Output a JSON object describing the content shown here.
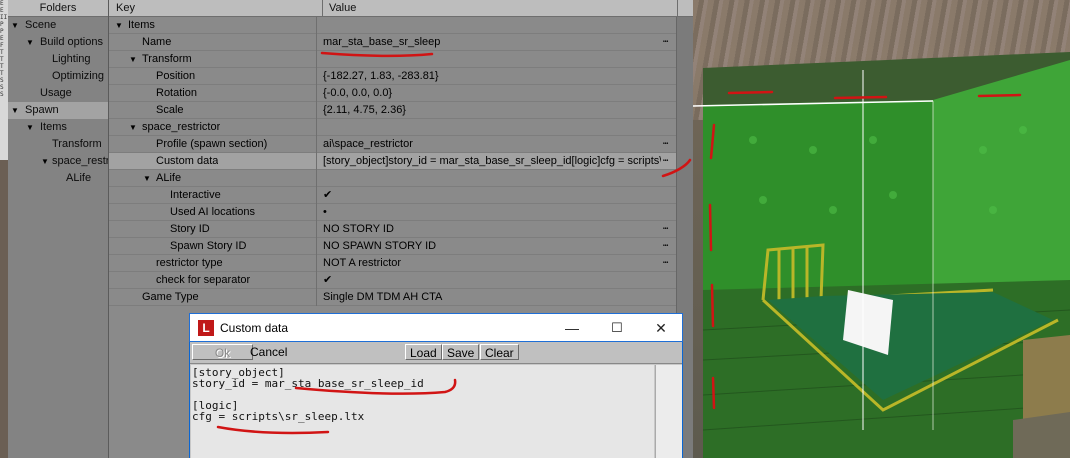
{
  "left_strip_letters": [
    "E",
    "E",
    "II",
    "",
    "P",
    "P",
    "E",
    "F",
    "",
    "T",
    "T",
    "T",
    "T",
    "",
    "S",
    "S",
    "S"
  ],
  "folders": {
    "header": "Folders",
    "items": [
      {
        "label": "Scene",
        "expanded": true
      },
      {
        "label": "Build options",
        "expanded": true
      },
      {
        "label": "Lighting"
      },
      {
        "label": "Optimizing"
      },
      {
        "label": "Usage"
      },
      {
        "label": "Spawn",
        "expanded": true,
        "selected": true
      },
      {
        "label": "Items",
        "expanded": true
      },
      {
        "label": "Transform"
      },
      {
        "label": "space_restrictor",
        "expanded": true
      },
      {
        "label": "ALife"
      }
    ]
  },
  "properties": {
    "key_header": "Key",
    "value_header": "Value",
    "rows": [
      {
        "key": "Items",
        "value": "",
        "expanded": true
      },
      {
        "key": "Name",
        "value": "mar_sta_base_sr_sleep",
        "has_button": true
      },
      {
        "key": "Transform",
        "value": "",
        "expanded": true
      },
      {
        "key": "Position",
        "value": "{-182.27, 1.83, -283.81}"
      },
      {
        "key": "Rotation",
        "value": "{-0.0, 0.0, 0.0}"
      },
      {
        "key": "Scale",
        "value": "{2.11, 4.75, 2.36}"
      },
      {
        "key": "space_restrictor",
        "value": "",
        "expanded": true
      },
      {
        "key": "Profile (spawn section)",
        "value": "ai\\space_restrictor",
        "has_button": true
      },
      {
        "key": "Custom data",
        "value": "[story_object]story_id = mar_sta_base_sr_sleep_id[logic]cfg = scripts\\sr_sleep.ltx",
        "has_button": true,
        "selected": true
      },
      {
        "key": "ALife",
        "value": "",
        "expanded": true
      },
      {
        "key": "Interactive",
        "value": "✔"
      },
      {
        "key": "Used AI locations",
        "value": "•"
      },
      {
        "key": "Story ID",
        "value": "NO STORY ID",
        "has_button": true
      },
      {
        "key": "Spawn Story ID",
        "value": "NO SPAWN STORY ID",
        "has_button": true
      },
      {
        "key": "restrictor type",
        "value": "NOT A restrictor",
        "has_button": true
      },
      {
        "key": "check for separator",
        "value": "✔"
      },
      {
        "key": "Game Type",
        "value": "Single DM TDM AH CTA"
      }
    ],
    "button_glyph": "•••"
  },
  "dialog": {
    "app_icon": "L",
    "title": "Custom data",
    "minimize": "—",
    "maximize": "☐",
    "close": "✕",
    "buttons": {
      "ok": "Ok",
      "cancel": "Cancel",
      "load": "Load",
      "save": "Save",
      "clear": "Clear"
    },
    "lines": [
      "[story_object]",
      "story_id = mar_sta_base_sr_sleep_id",
      "",
      "[logic]",
      "cfg = scripts\\sr_sleep.ltx"
    ]
  },
  "colors": {
    "annotation_red": "#d11414",
    "trigger_green": "#2faa2a",
    "dialog_border": "#0a66d3"
  }
}
